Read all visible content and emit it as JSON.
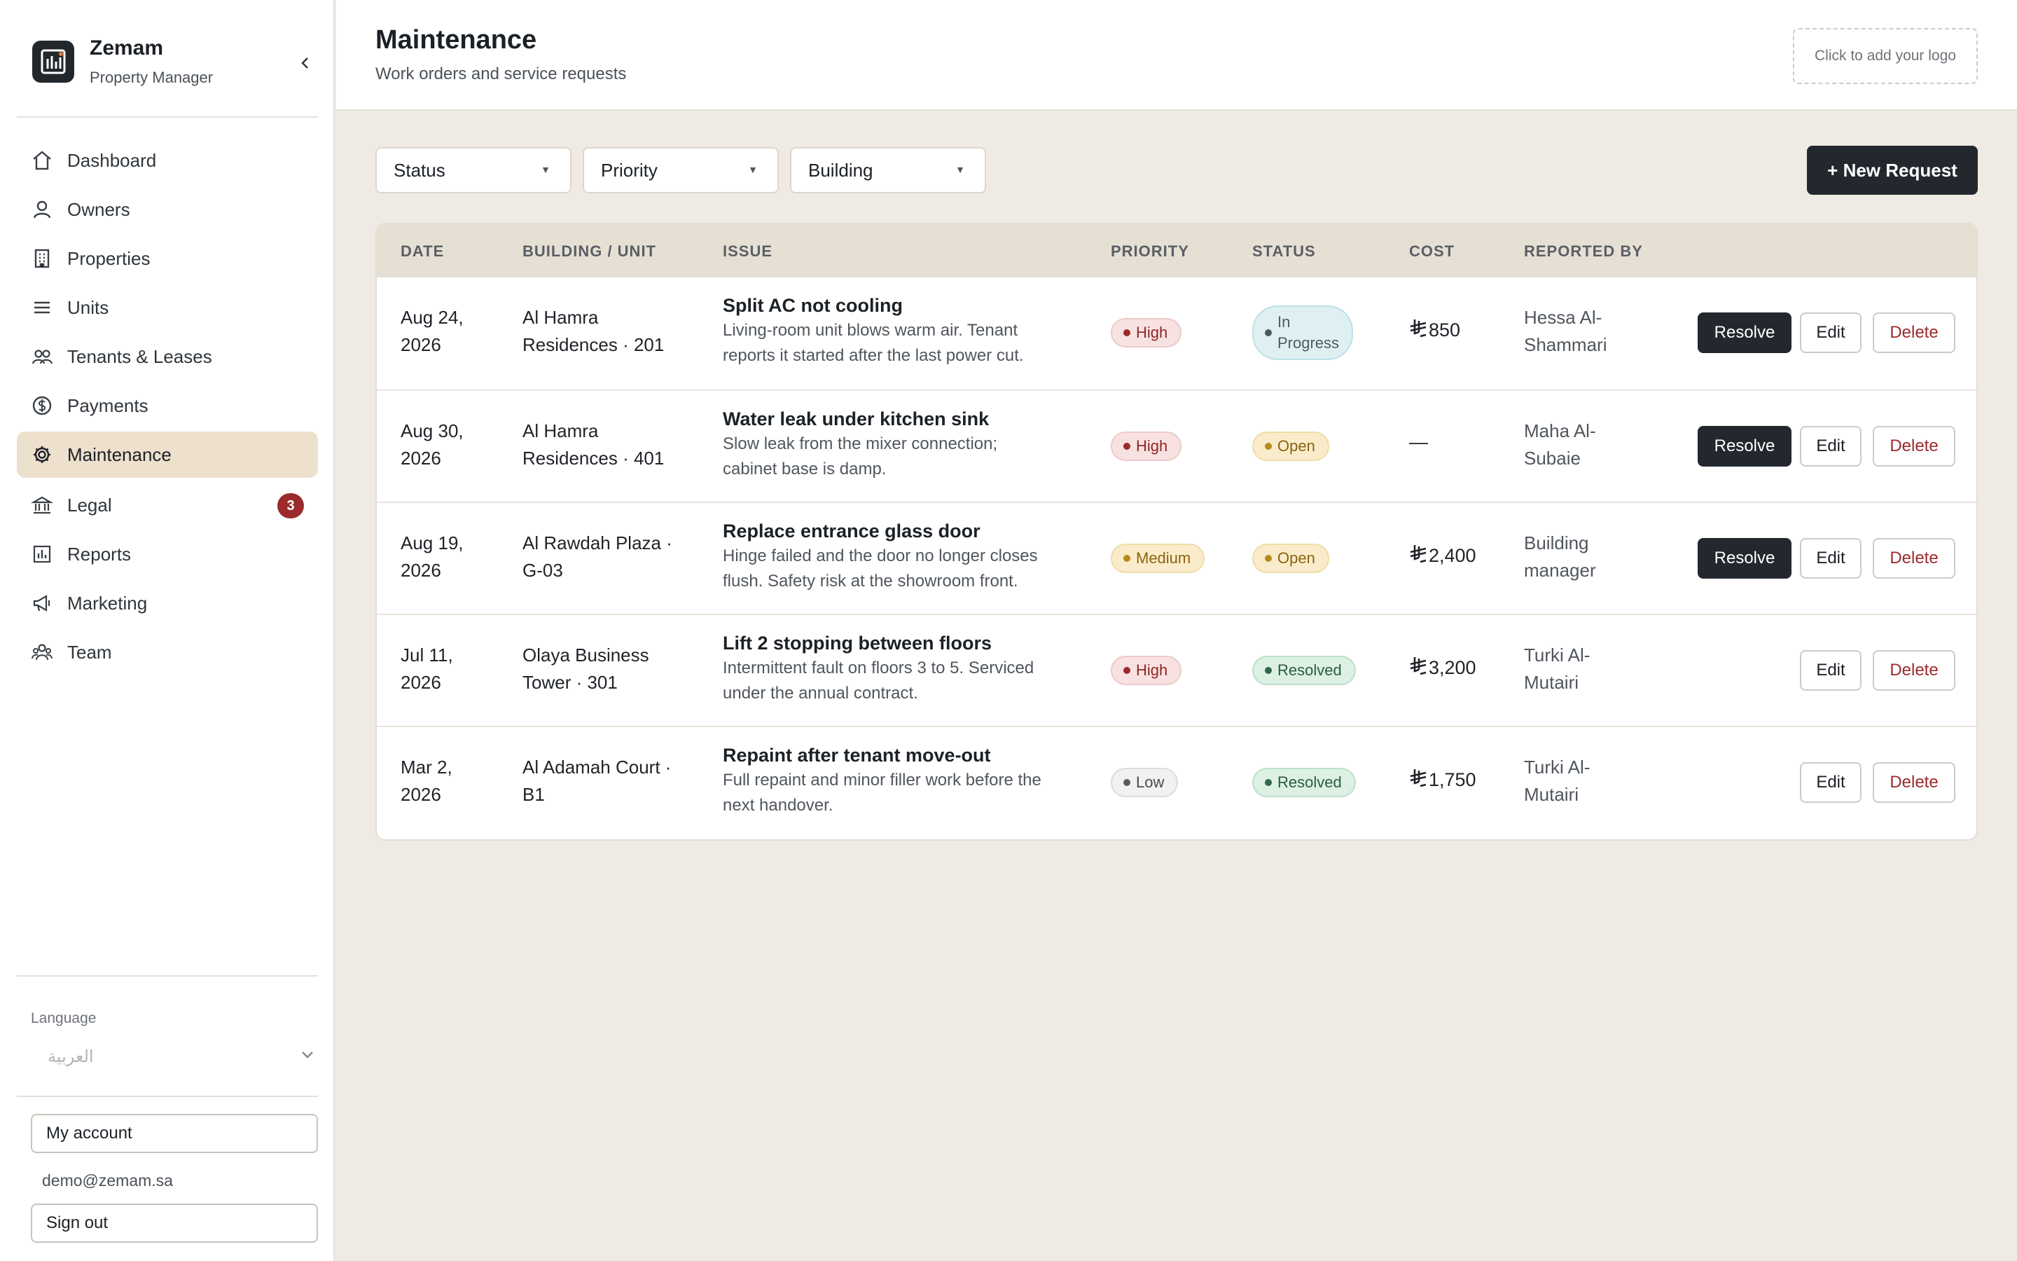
{
  "brand": {
    "name": "Zemam",
    "subtitle": "Property Manager"
  },
  "nav": [
    {
      "label": "Dashboard",
      "icon": "home-icon"
    },
    {
      "label": "Owners",
      "icon": "user-icon"
    },
    {
      "label": "Properties",
      "icon": "building-icon"
    },
    {
      "label": "Units",
      "icon": "list-icon"
    },
    {
      "label": "Tenants & Leases",
      "icon": "users-icon"
    },
    {
      "label": "Payments",
      "icon": "dollar-icon"
    },
    {
      "label": "Maintenance",
      "icon": "gear-icon",
      "active": true
    },
    {
      "label": "Legal",
      "icon": "bank-icon",
      "badge": "3"
    },
    {
      "label": "Reports",
      "icon": "bar-chart-icon"
    },
    {
      "label": "Marketing",
      "icon": "megaphone-icon"
    },
    {
      "label": "Team",
      "icon": "team-icon"
    }
  ],
  "sidebar_footer": {
    "language_label": "Language",
    "language_value": "العربية",
    "my_account": "My account",
    "email": "demo@zemam.sa",
    "sign_out": "Sign out"
  },
  "header": {
    "title": "Maintenance",
    "subtitle": "Work orders and service requests",
    "logo_placeholder": "Click to add your logo"
  },
  "filters": {
    "status": "Status",
    "priority": "Priority",
    "building": "Building"
  },
  "new_request": "+ New Request",
  "table": {
    "columns": [
      "DATE",
      "BUILDING / UNIT",
      "ISSUE",
      "PRIORITY",
      "STATUS",
      "COST",
      "REPORTED BY"
    ],
    "rows": [
      {
        "date": [
          "Aug 24,",
          "2026"
        ],
        "unit": [
          "Al Hamra",
          "Residences · 201"
        ],
        "issue_title": "Split AC not cooling",
        "issue_desc": [
          "Living-room unit blows warm air. Tenant",
          "reports it started after the last power cut."
        ],
        "priority": "High",
        "status": [
          "In",
          "Progress"
        ],
        "status_kind": "progress",
        "cost": "850",
        "reporter": [
          "Hessa Al-",
          "Shammari"
        ],
        "resolve": "Resolve"
      },
      {
        "date": [
          "Aug 30,",
          "2026"
        ],
        "unit": [
          "Al Hamra",
          "Residences · 401"
        ],
        "issue_title": "Water leak under kitchen sink",
        "issue_desc": [
          "Slow leak from the mixer connection;",
          "cabinet base is damp."
        ],
        "priority": "High",
        "status": [
          "Open"
        ],
        "status_kind": "open",
        "cost": "—",
        "reporter": [
          "Maha Al-",
          "Subaie"
        ],
        "resolve": "Resolve"
      },
      {
        "date": [
          "Aug 19,",
          "2026"
        ],
        "unit": [
          "Al Rawdah Plaza ·",
          "G-03"
        ],
        "issue_title": "Replace entrance glass door",
        "issue_desc": [
          "Hinge failed and the door no longer closes",
          "flush. Safety risk at the showroom front."
        ],
        "priority": "Medium",
        "status": [
          "Open"
        ],
        "status_kind": "open",
        "cost": "2,400",
        "reporter": [
          "Building",
          "manager"
        ],
        "resolve": "Resolve"
      },
      {
        "date": [
          "Jul 11,",
          "2026"
        ],
        "unit": [
          "Olaya Business",
          "Tower · 301"
        ],
        "issue_title": "Lift 2 stopping between floors",
        "issue_desc": [
          "Intermittent fault on floors 3 to 5. Serviced",
          "under the annual contract."
        ],
        "priority": "High",
        "status": [
          "Resolved"
        ],
        "status_kind": "resolved",
        "cost": "3,200",
        "reporter": [
          "Turki Al-",
          "Mutairi"
        ]
      },
      {
        "date": [
          "Mar 2,",
          "2026"
        ],
        "unit": [
          "Al Adamah Court ·",
          "B1"
        ],
        "issue_title": "Repaint after tenant move-out",
        "issue_desc": [
          "Full repaint and minor filler work before the",
          "next handover."
        ],
        "priority": "Low",
        "status": [
          "Resolved"
        ],
        "status_kind": "resolved",
        "cost": "1,750",
        "reporter": [
          "Turki Al-",
          "Mutairi"
        ]
      }
    ],
    "edit_label": "Edit",
    "delete_label": "Delete"
  },
  "colors": {
    "accent_dark": "#22282e",
    "active_nav": "#ede0cc",
    "danger": "#9b2b2b",
    "background": "#efebe4"
  }
}
